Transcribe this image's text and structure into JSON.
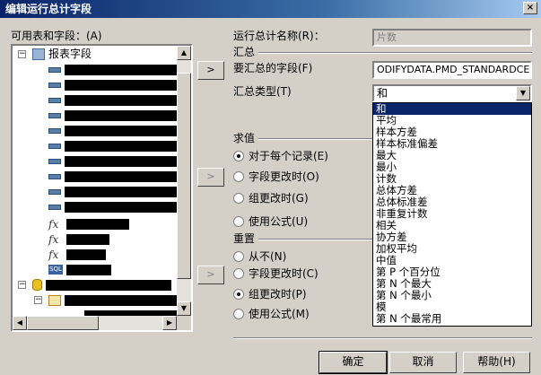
{
  "window": {
    "title": "编辑运行总计字段",
    "close_glyph": "×"
  },
  "left": {
    "available_label": "可用表和字段：(A)",
    "tree": {
      "report_fields": "报表字段",
      "formulas": [
        "fx",
        "fx",
        "fx"
      ],
      "sql_icon_text": "SQL"
    }
  },
  "buttons": {
    "move_right": ">",
    "ok": "确定",
    "cancel": "取消",
    "help": "帮助(H)"
  },
  "form": {
    "name_label": "运行总计名称(R)：",
    "name_value": "片数",
    "summary_heading": "汇总",
    "field_label": "要汇总的字段(F)",
    "field_value": "ODIFYDATA.PMD_STANDARDCELLS",
    "type_label": "汇总类型(T)",
    "type_value": "和"
  },
  "evaluate": {
    "heading": "求值",
    "options": [
      "对于每个记录(E)",
      "字段更改时(O)",
      "组更改时(G)",
      "使用公式(U)"
    ],
    "selected": 0
  },
  "reset": {
    "heading": "重置",
    "options": [
      "从不(N)",
      "字段更改时(C)",
      "组更改时(P)",
      "使用公式(M)"
    ],
    "selected": 2
  },
  "dropdown": {
    "items": [
      "和",
      "平均",
      "样本方差",
      "样本标准偏差",
      "最大",
      "最小",
      "计数",
      "总体方差",
      "总体标准差",
      "非重复计数",
      "相关",
      "协方差",
      "加权平均",
      "中值",
      "第 P 个百分位",
      "第 N 个最大",
      "第 N 个最小",
      "模",
      "第 N 个最常用"
    ],
    "selected": 0
  },
  "colors": {
    "title_start": "#0a246a",
    "title_end": "#a6caf0",
    "selection": "#0a246a",
    "face": "#d4d0c8"
  }
}
